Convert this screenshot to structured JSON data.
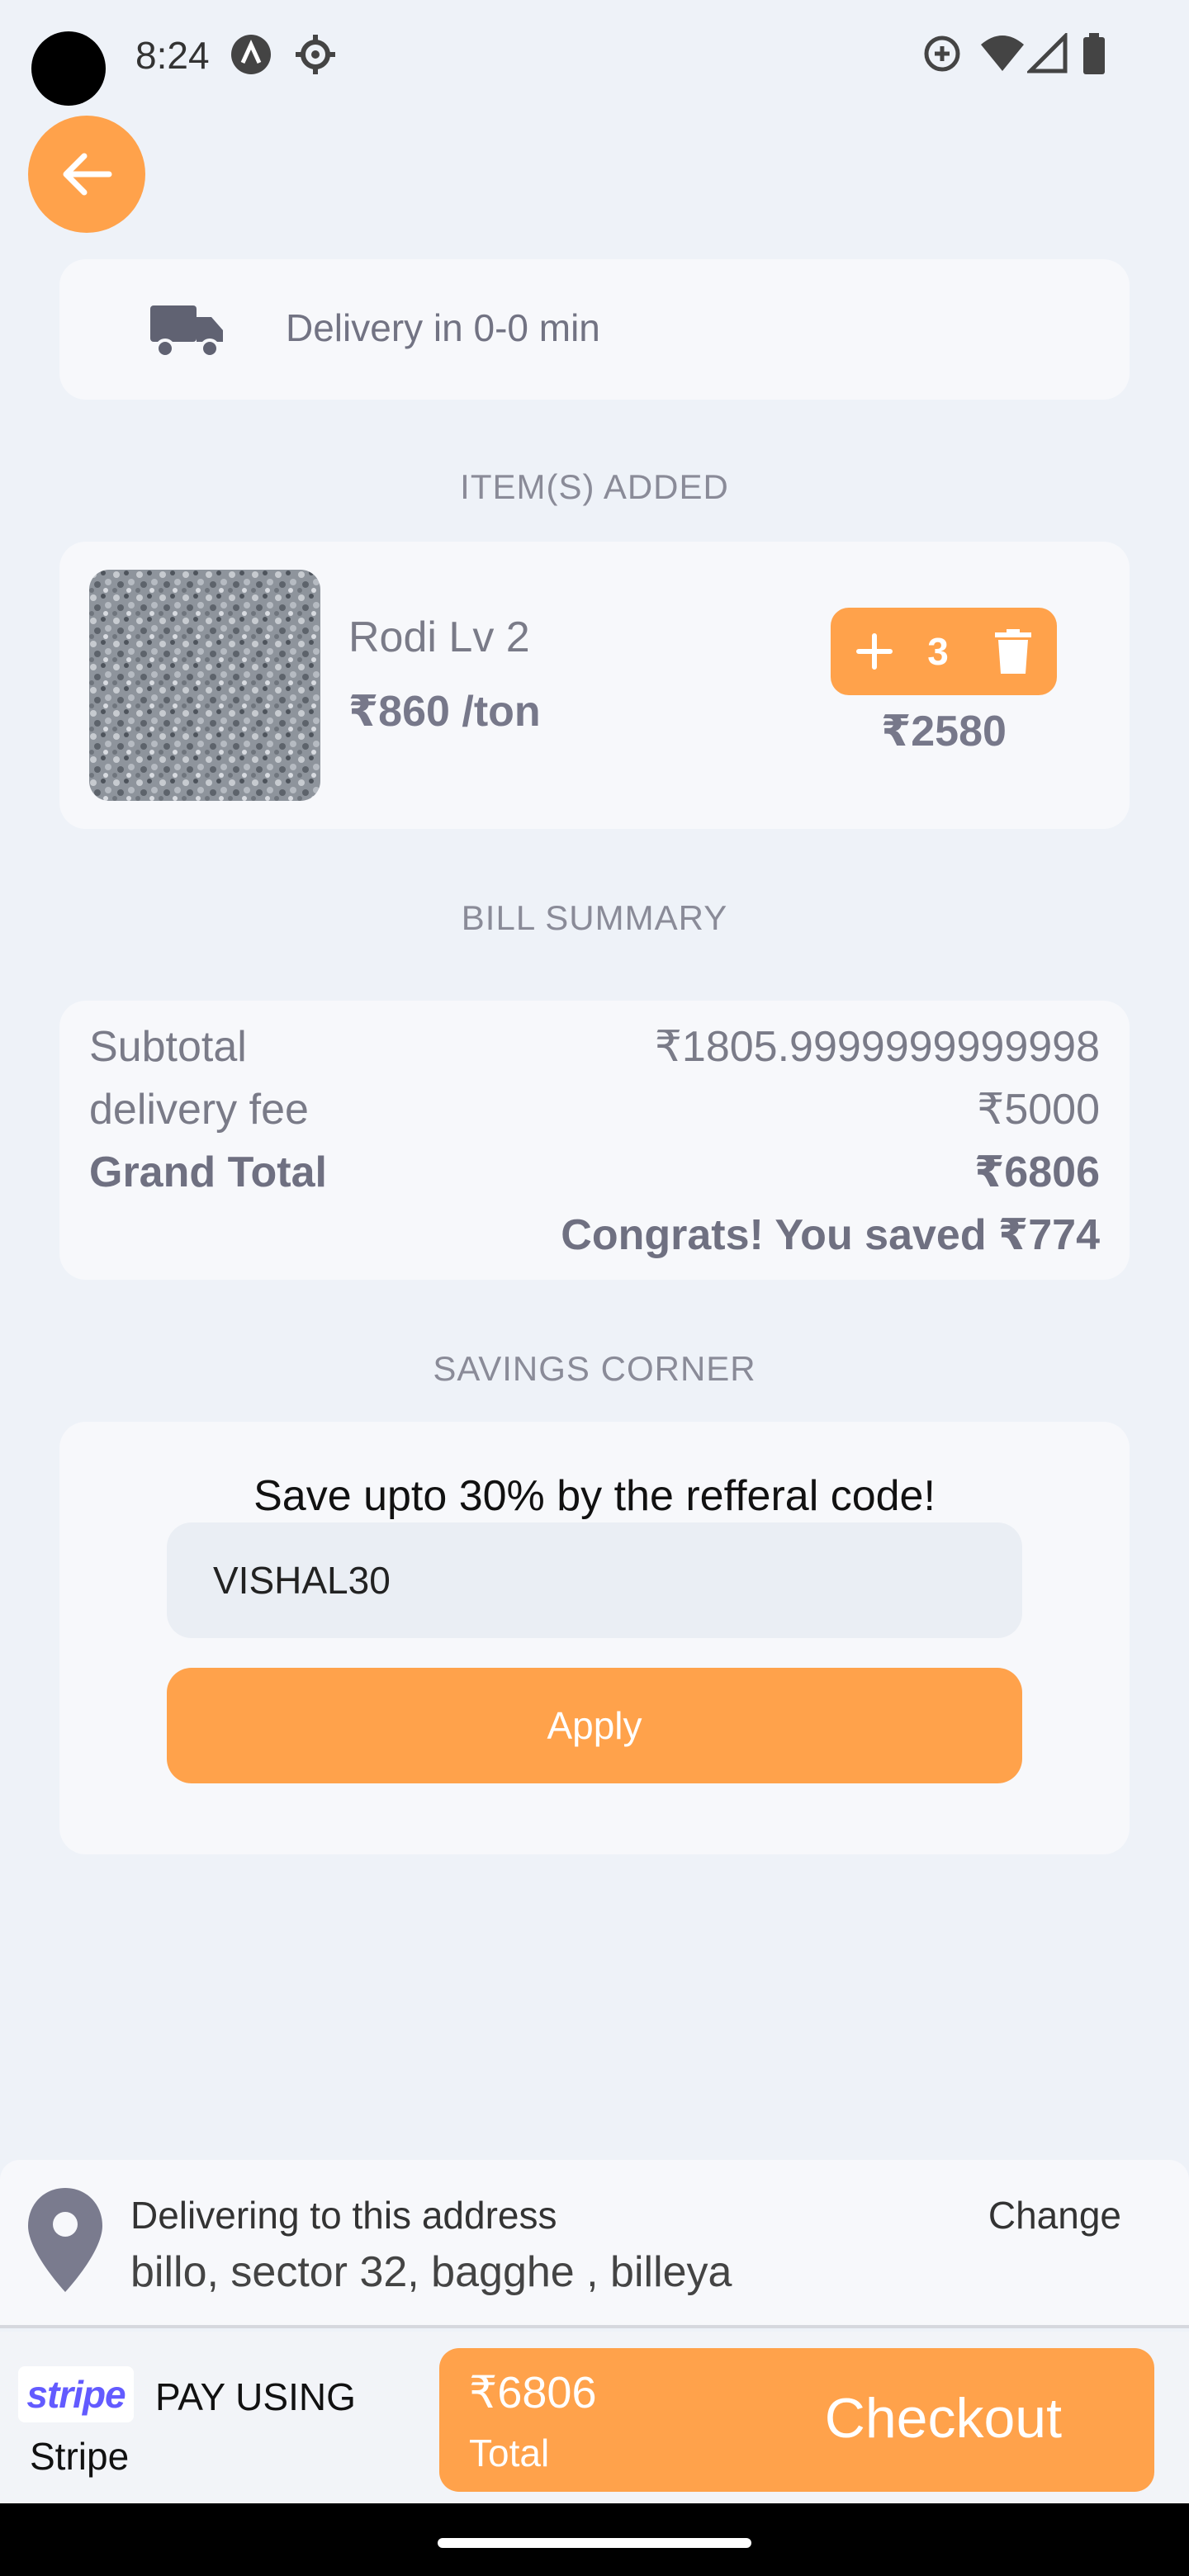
{
  "status_bar": {
    "time": "8:24"
  },
  "delivery": {
    "text": "Delivery in 0-0 min"
  },
  "items_section": {
    "title": "ITEM(S) ADDED"
  },
  "item": {
    "name": "Rodi Lv 2",
    "price": "₹860 /ton",
    "quantity": "3",
    "total": "₹2580"
  },
  "bill_section": {
    "title": "BILL SUMMARY"
  },
  "bill": {
    "subtotal_label": "Subtotal",
    "subtotal_value": "₹1805.9999999999998",
    "delivery_label": "delivery fee",
    "delivery_value": "₹5000",
    "grand_label": "Grand Total",
    "grand_value": "₹6806",
    "savings_note": "Congrats! You saved ₹774"
  },
  "savings_section": {
    "title": "SAVINGS CORNER"
  },
  "savings": {
    "headline": "Save upto 30% by the refferal code!",
    "code_value": "VISHAL30",
    "apply_label": "Apply"
  },
  "address": {
    "label": "Delivering to this address",
    "value": "billo, sector 32, bagghe , billeya",
    "change_label": "Change"
  },
  "payment": {
    "logo_text": "stripe",
    "pay_using": "PAY USING",
    "provider": "Stripe"
  },
  "checkout": {
    "amount": "₹6806",
    "amount_label": "Total",
    "button_label": "Checkout"
  },
  "colors": {
    "accent": "#ffa24b",
    "background": "#eef2f8",
    "card": "#f7f8fb",
    "stripe": "#635bff"
  },
  "icons": [
    "back-arrow-icon",
    "truck-icon",
    "plus-icon",
    "trash-icon",
    "location-pin-icon",
    "wifi-icon",
    "signal-icon",
    "battery-icon"
  ]
}
